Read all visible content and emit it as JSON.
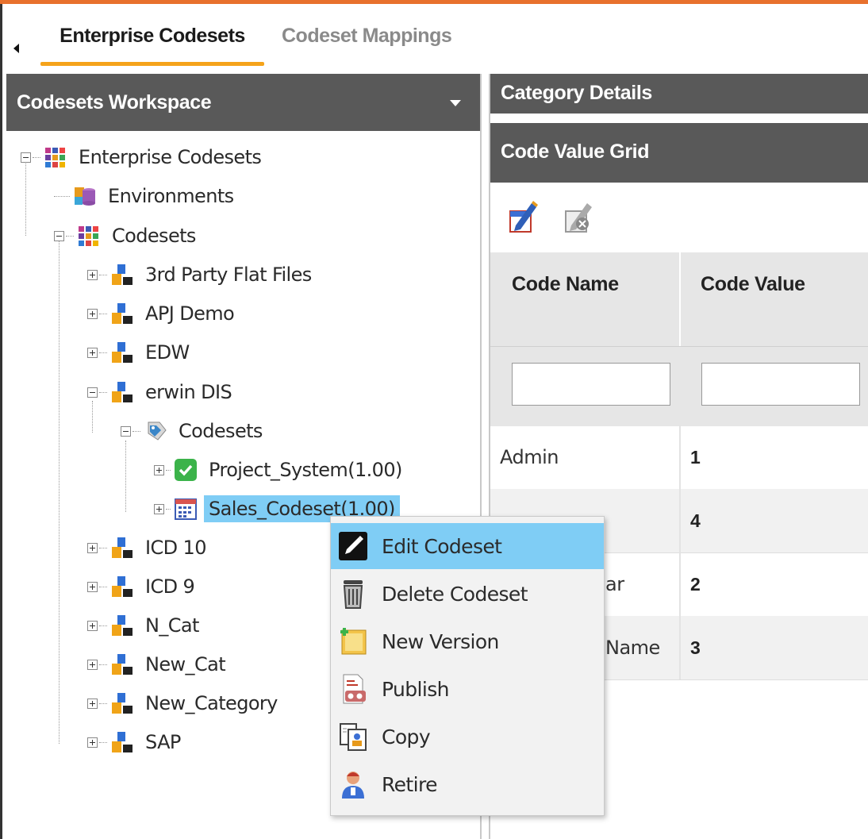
{
  "colors": {
    "accent": "#e8712d",
    "tab_underline": "#f5a31a",
    "header_bg": "#595959",
    "selection": "#7fcdf5"
  },
  "tabs": {
    "active": "Enterprise Codesets",
    "inactive": "Codeset Mappings"
  },
  "workspace": {
    "title": "Codesets Workspace",
    "tree": {
      "root": "Enterprise Codesets",
      "environments": "Environments",
      "codesets": "Codesets",
      "categories": [
        "3rd Party Flat Files",
        "APJ Demo",
        "EDW",
        "erwin DIS",
        "ICD 10",
        "ICD 9",
        "N_Cat",
        "New_Cat",
        "New_Category",
        "SAP"
      ],
      "erwin_codesets": "Codesets",
      "project_system": "Project_System(1.00)",
      "sales_codeset": "Sales_Codeset(1.00)"
    }
  },
  "right_panel": {
    "category_details": "Category Details",
    "grid_title": "Code Value Grid",
    "toolbar_icons": [
      "edit-icon",
      "delete-disabled-icon"
    ],
    "columns": [
      "Code Name",
      "Code Value"
    ],
    "rows": [
      {
        "name": "Admin",
        "value": "1"
      },
      {
        "name": "",
        "value": "4"
      },
      {
        "name": "ar",
        "value": "2"
      },
      {
        "name": "Name",
        "value": "3"
      }
    ]
  },
  "context_menu": {
    "items": [
      {
        "label": "Edit Codeset",
        "icon": "edit-pencil-icon"
      },
      {
        "label": "Delete Codeset",
        "icon": "trash-icon"
      },
      {
        "label": "New Version",
        "icon": "new-version-icon"
      },
      {
        "label": "Publish",
        "icon": "publish-icon"
      },
      {
        "label": "Copy",
        "icon": "copy-icon"
      },
      {
        "label": "Retire",
        "icon": "retire-user-icon"
      }
    ]
  }
}
